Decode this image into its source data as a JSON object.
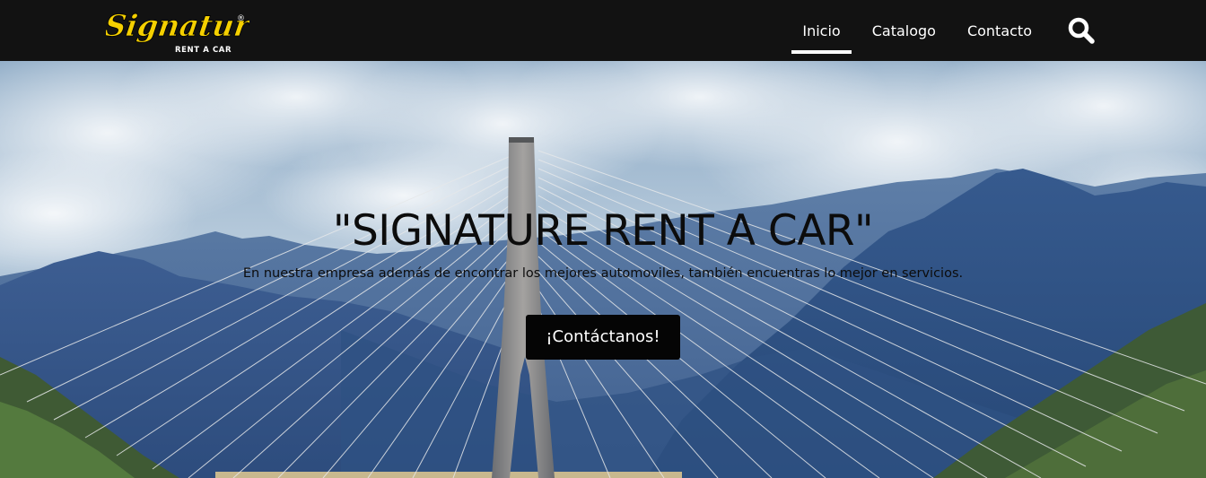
{
  "brand": {
    "name": "Signature",
    "tagline": "RENT A CAR",
    "registered": "®",
    "colors": {
      "logo_yellow": "#F5D000",
      "navbar_bg": "#121212"
    }
  },
  "nav": {
    "items": [
      {
        "label": "Inicio",
        "active": true
      },
      {
        "label": "Catalogo",
        "active": false
      },
      {
        "label": "Contacto",
        "active": false
      }
    ],
    "search_icon": "search-icon"
  },
  "hero": {
    "title": "\"SIGNATURE RENT A CAR\"",
    "subtitle": "En nuestra empresa además de encontrar los mejores automoviles, también encuentras lo mejor en servicios.",
    "cta_label": "¡Contáctanos!",
    "background": "cable-stayed bridge between mountains under cloudy sky"
  }
}
